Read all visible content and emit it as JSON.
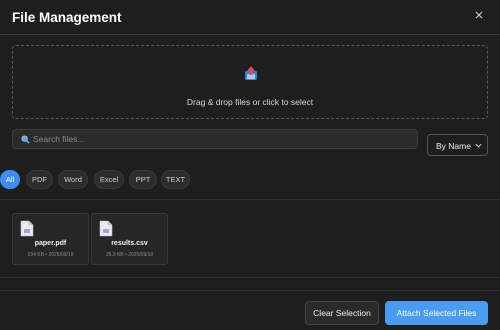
{
  "header": {
    "title": "File Management",
    "close_label": "×"
  },
  "dropzone": {
    "icon": "upload-icon",
    "text": "Drag & drop files or click to select"
  },
  "search": {
    "placeholder": "Search files...",
    "value": ""
  },
  "sort": {
    "selected": "By Name"
  },
  "filters": [
    {
      "label": "All",
      "active": true
    },
    {
      "label": "PDF",
      "active": false
    },
    {
      "label": "Word",
      "active": false
    },
    {
      "label": "Excel",
      "active": false
    },
    {
      "label": "PPT",
      "active": false
    },
    {
      "label": "TEXT",
      "active": false
    }
  ],
  "files": [
    {
      "name": "paper.pdf",
      "meta": "194 KB • 2025/09/18",
      "icon": "document-icon"
    },
    {
      "name": "results.csv",
      "meta": "35.9 KB • 2025/09/18",
      "icon": "document-icon"
    }
  ],
  "footer": {
    "clear_label": "Clear Selection",
    "attach_label": "Attach Selected Files"
  },
  "colors": {
    "accent": "#4a9cf2",
    "background": "#1e1e1e"
  }
}
